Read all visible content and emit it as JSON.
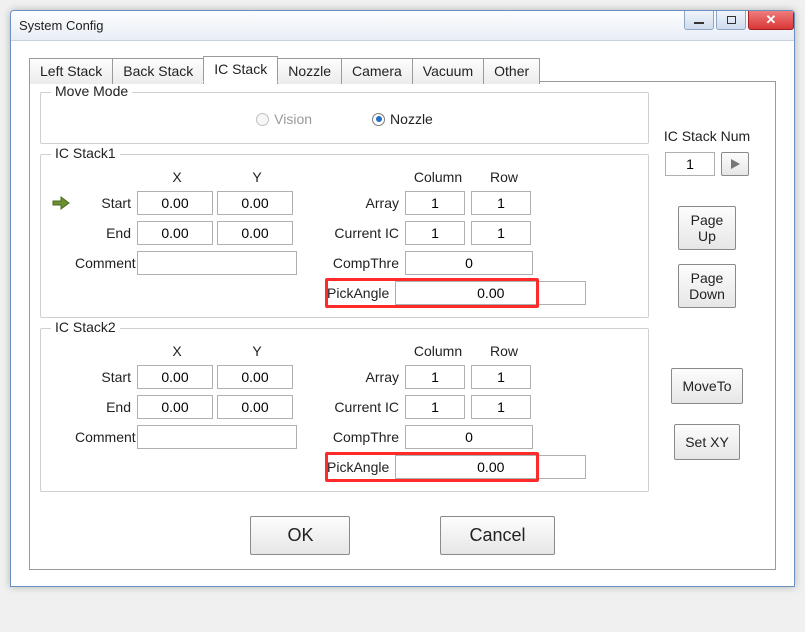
{
  "window": {
    "title": "System Config"
  },
  "tabs": {
    "items": [
      "Left Stack",
      "Back Stack",
      "IC Stack",
      "Nozzle",
      "Camera",
      "Vacuum",
      "Other"
    ],
    "active_index": 2
  },
  "move_mode": {
    "legend": "Move Mode",
    "options": {
      "vision": "Vision",
      "nozzle": "Nozzle"
    },
    "selected": "nozzle",
    "vision_disabled": true
  },
  "ic_stack_num": {
    "label": "IC Stack Num",
    "value": "1"
  },
  "side_buttons": {
    "page_up": "Page\nUp",
    "page_down": "Page\nDown",
    "move_to": "MoveTo",
    "set_xy": "Set XY"
  },
  "headers": {
    "x": "X",
    "y": "Y",
    "column": "Column",
    "row": "Row",
    "start": "Start",
    "end": "End",
    "comment": "Comment",
    "array": "Array",
    "current_ic": "Current IC",
    "comp_thre": "CompThre",
    "pick_angle": "PickAngle"
  },
  "stacks": [
    {
      "legend": "IC Stack1",
      "show_arrow": true,
      "start_x": "0.00",
      "start_y": "0.00",
      "end_x": "0.00",
      "end_y": "0.00",
      "comment": "",
      "array_col": "1",
      "array_row": "1",
      "cur_col": "1",
      "cur_row": "1",
      "comp_thre": "0",
      "pick_angle": "0.00"
    },
    {
      "legend": "IC Stack2",
      "show_arrow": false,
      "start_x": "0.00",
      "start_y": "0.00",
      "end_x": "0.00",
      "end_y": "0.00",
      "comment": "",
      "array_col": "1",
      "array_row": "1",
      "cur_col": "1",
      "cur_row": "1",
      "comp_thre": "0",
      "pick_angle": "0.00"
    }
  ],
  "footer": {
    "ok": "OK",
    "cancel": "Cancel"
  }
}
